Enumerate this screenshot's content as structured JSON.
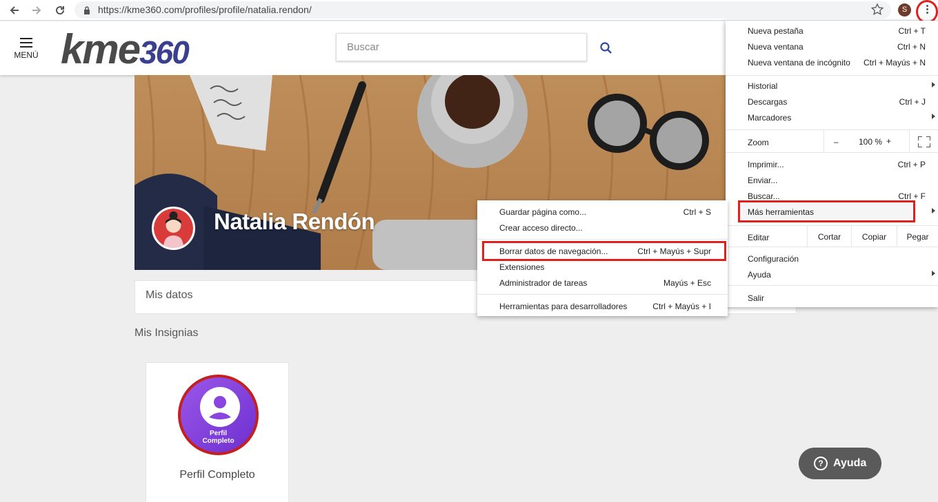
{
  "browser": {
    "url": "https://kme360.com/profiles/profile/natalia.rendon/",
    "profile_initial": "S"
  },
  "header": {
    "menu_label": "MENÚ",
    "logo_main": "kme",
    "logo_num": "360",
    "search_placeholder": "Buscar"
  },
  "profile": {
    "name": "Natalia Rendón",
    "mis_datos": "Mis datos",
    "insignias_title": "Mis Insignias",
    "badge_line1": "Perfil",
    "badge_line2": "Completo",
    "badge_label": "Perfil Completo"
  },
  "help_button": "Ayuda",
  "chrome_menu": {
    "new_tab": {
      "label": "Nueva pestaña",
      "shortcut": "Ctrl + T"
    },
    "new_window": {
      "label": "Nueva ventana",
      "shortcut": "Ctrl + N"
    },
    "incognito": {
      "label": "Nueva ventana de incógnito",
      "shortcut": "Ctrl + Mayús + N"
    },
    "history": {
      "label": "Historial"
    },
    "downloads": {
      "label": "Descargas",
      "shortcut": "Ctrl + J"
    },
    "bookmarks": {
      "label": "Marcadores"
    },
    "zoom": {
      "label": "Zoom",
      "minus": "–",
      "value": "100 %",
      "plus": "+"
    },
    "print": {
      "label": "Imprimir...",
      "shortcut": "Ctrl + P"
    },
    "cast": {
      "label": "Enviar..."
    },
    "find": {
      "label": "Buscar...",
      "shortcut": "Ctrl + F"
    },
    "more_tools": {
      "label": "Más herramientas"
    },
    "edit": {
      "label": "Editar",
      "cut": "Cortar",
      "copy": "Copiar",
      "paste": "Pegar"
    },
    "settings": {
      "label": "Configuración"
    },
    "help": {
      "label": "Ayuda"
    },
    "exit": {
      "label": "Salir"
    }
  },
  "more_tools_menu": {
    "save_page": {
      "label": "Guardar página como...",
      "shortcut": "Ctrl + S"
    },
    "create_shortcut": {
      "label": "Crear acceso directo..."
    },
    "clear_data": {
      "label": "Borrar datos de navegación...",
      "shortcut": "Ctrl + Mayús + Supr"
    },
    "extensions": {
      "label": "Extensiones"
    },
    "task_manager": {
      "label": "Administrador de tareas",
      "shortcut": "Mayús + Esc"
    },
    "dev_tools": {
      "label": "Herramientas para desarrolladores",
      "shortcut": "Ctrl + Mayús + I"
    }
  },
  "colors": {
    "highlight_red": "#e0201c",
    "logo_gray": "#4a4a4a",
    "logo_blue": "#3a3f8f",
    "badge_purple": "#8a45e0"
  }
}
